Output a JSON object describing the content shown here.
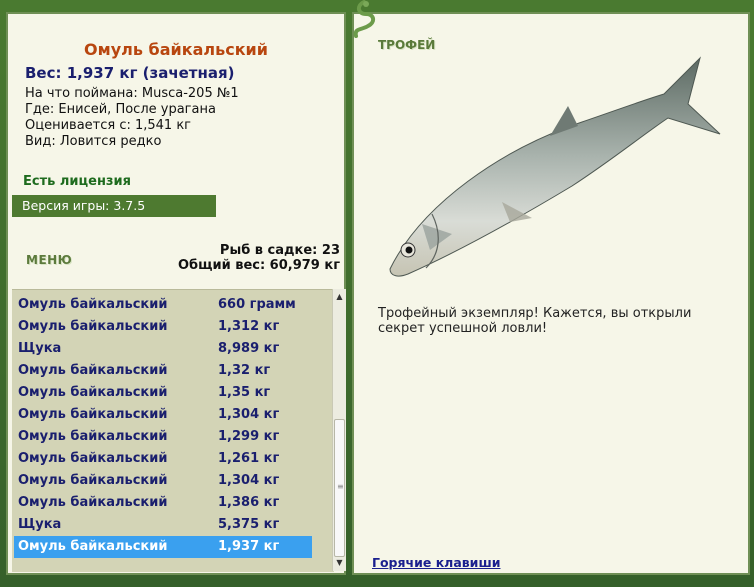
{
  "fish_info": {
    "title": "Омуль байкальский",
    "weight_line": "Вес: 1,937 кг (зачетная)",
    "bait_line": "На что поймана: Musca-205 №1",
    "where_line": "Где: Енисей, После урагана",
    "score_line": "Оценивается с: 1,541 кг",
    "kind_line": "Вид: Ловится редко"
  },
  "license": "Есть лицензия",
  "version": "Версия игры: 3.7.5",
  "menu_label": "МЕНЮ",
  "keepnet": {
    "count_line": "Рыб в садке: 23",
    "weight_line": "Общий вес: 60,979 кг"
  },
  "fish_list": [
    {
      "name": "Омуль байкальский",
      "weight": "660 грамм"
    },
    {
      "name": "Омуль байкальский",
      "weight": "1,312 кг"
    },
    {
      "name": "Щука",
      "weight": "8,989 кг"
    },
    {
      "name": "Омуль байкальский",
      "weight": "1,32 кг"
    },
    {
      "name": "Омуль байкальский",
      "weight": "1,35 кг"
    },
    {
      "name": "Омуль байкальский",
      "weight": "1,304 кг"
    },
    {
      "name": "Омуль байкальский",
      "weight": "1,299 кг"
    },
    {
      "name": "Омуль байкальский",
      "weight": "1,261 кг"
    },
    {
      "name": "Омуль байкальский",
      "weight": "1,304 кг"
    },
    {
      "name": "Омуль байкальский",
      "weight": "1,386 кг"
    },
    {
      "name": "Щука",
      "weight": "5,375 кг"
    },
    {
      "name": "Омуль байкальский",
      "weight": "1,937 кг",
      "selected": true
    }
  ],
  "trophy": {
    "label": "ТРОФЕЙ",
    "text": "Трофейный экземпляр! Кажется, вы открыли секрет успешной ловли!"
  },
  "hotkeys_link": "Горячие клавиши",
  "colors": {
    "title": "#b8460f",
    "weight": "#1a1f6e",
    "license": "#1e6b1e",
    "version_bg": "#4e7a30",
    "selected_row": "#3aa0ef"
  },
  "icons": [
    "gecko-icon",
    "scroll-up-icon",
    "scroll-down-icon",
    "fish-image"
  ]
}
